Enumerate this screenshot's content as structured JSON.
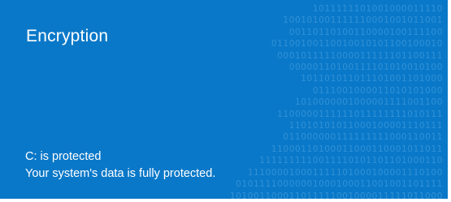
{
  "tile": {
    "title": "Encryption",
    "status": "C: is protected",
    "detail": "Your system's data is fully protected."
  },
  "colors": {
    "background": "#0a78c8",
    "text": "#ffffff",
    "binary_pattern": "#4fa6e4"
  },
  "decoration": {
    "icon": "binary-digits-pattern"
  }
}
